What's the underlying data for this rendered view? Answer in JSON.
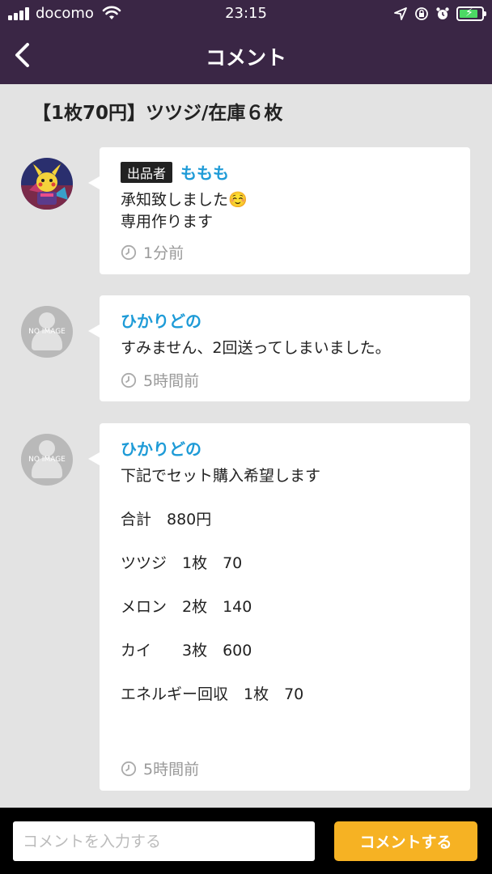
{
  "status_bar": {
    "carrier": "docomo",
    "time": "23:15",
    "battery_color": "#4cd964"
  },
  "header": {
    "title": "コメント",
    "back_icon": "chevron-left-icon",
    "background": "#3a2645"
  },
  "item_title": "【1枚70円】ツツジ/在庫６枚",
  "comments": [
    {
      "avatar": "pikachu-avatar",
      "badge": "出品者",
      "name": "ももも",
      "message": "承知致しました☺️\n専用作ります",
      "time": "1分前"
    },
    {
      "avatar_label": "NO IMAGE",
      "name": "ひかりどの",
      "message": "すみません、2回送ってしまいました。",
      "time": "5時間前"
    },
    {
      "avatar_label": "NO IMAGE",
      "name": "ひかりどの",
      "message_lines": [
        "下記でセット購入希望します",
        "合計　880円",
        "ツツジ　1枚　70",
        "メロン　2枚　140",
        "カイ　　3枚　600",
        "エネルギー回収　1枚　70"
      ],
      "time": "5時間前"
    }
  ],
  "input": {
    "placeholder": "コメントを入力する",
    "value": "",
    "submit_label": "コメントする",
    "submit_color": "#f6b223"
  },
  "colors": {
    "name": "#1e9bd7",
    "background": "#e3e3e3"
  }
}
